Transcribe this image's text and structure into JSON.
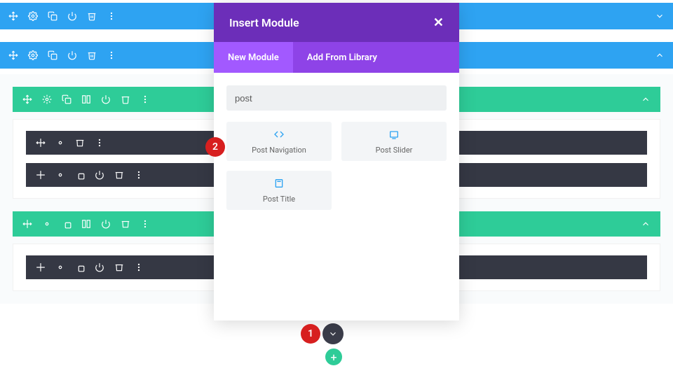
{
  "modal": {
    "title": "Insert Module",
    "tabs": {
      "new": "New Module",
      "library": "Add From Library"
    },
    "search_value": "post",
    "modules": {
      "nav": "Post Navigation",
      "slider": "Post Slider",
      "title": "Post Title"
    }
  },
  "markers": {
    "one": "1",
    "two": "2"
  }
}
